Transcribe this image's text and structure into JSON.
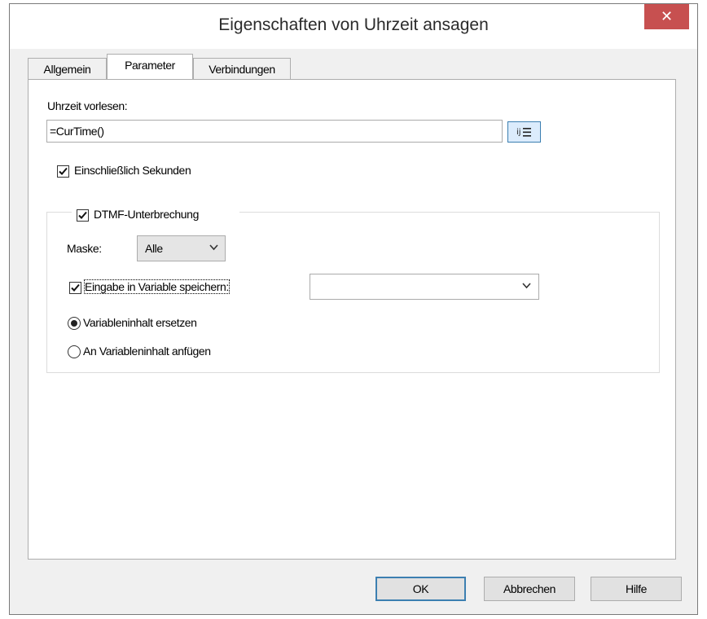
{
  "window": {
    "title": "Eigenschaften von Uhrzeit ansagen",
    "close_glyph": "✕"
  },
  "tabs": [
    {
      "label": "Allgemein",
      "active": false
    },
    {
      "label": "Parameter",
      "active": true
    },
    {
      "label": "Verbindungen",
      "active": false
    }
  ],
  "uhrzeit": {
    "label": "Uhrzeit vorlesen:",
    "value": "=CurTime()"
  },
  "seconds": {
    "label": "Einschließlich Sekunden",
    "checked": true
  },
  "dtmf": {
    "label": "DTMF-Unterbrechung",
    "checked": true,
    "mask_label": "Maske:",
    "mask_value": "Alle",
    "store_label": "Eingabe in Variable speichern:",
    "store_checked": true,
    "variable_value": "",
    "options": [
      {
        "label": "Variableninhalt ersetzen",
        "selected": true
      },
      {
        "label": "An Variableninhalt anfügen",
        "selected": false
      }
    ]
  },
  "buttons": {
    "ok": "OK",
    "cancel": "Abbrechen",
    "help": "Hilfe"
  },
  "colors": {
    "close_bg": "#c75050",
    "focus_border": "#3c7fb1",
    "dialog_bg": "#f0f0f0"
  },
  "icons": {
    "expression": "expression-editor-icon",
    "dropdown": "chevron-down-icon",
    "close": "close-icon"
  }
}
